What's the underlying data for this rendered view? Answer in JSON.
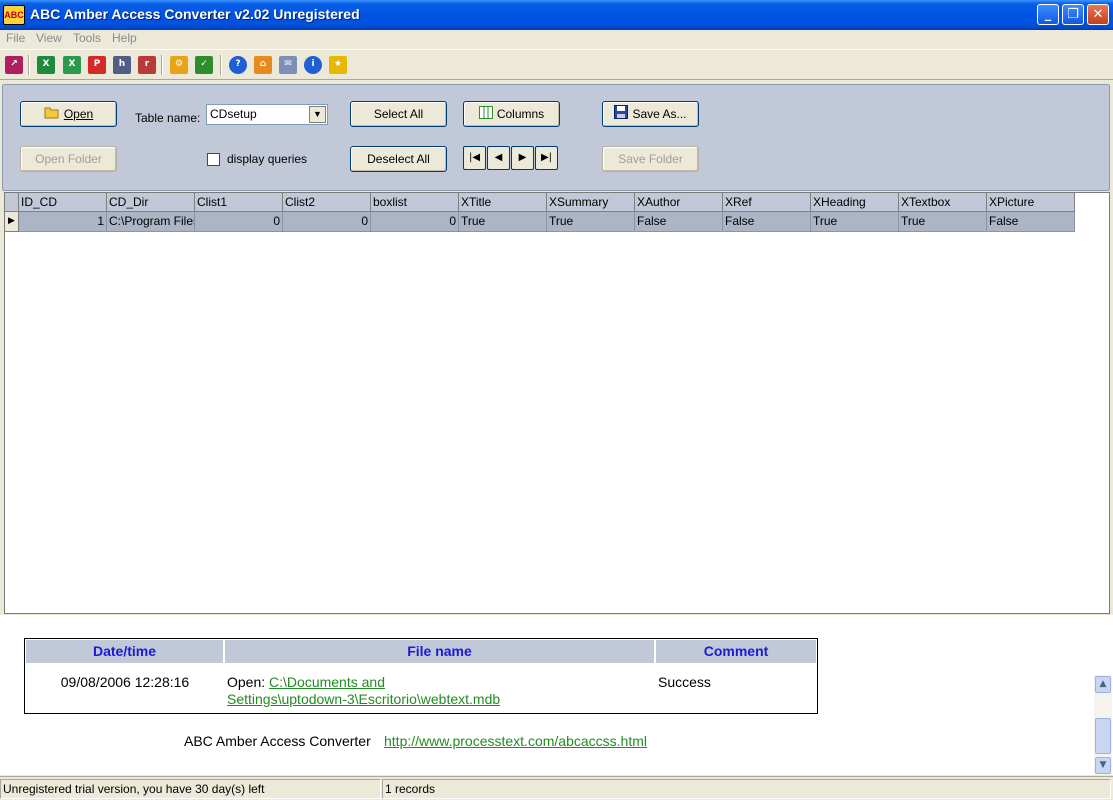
{
  "window": {
    "title": "ABC Amber Access Converter v2.02 Unregistered",
    "icon": "abc-app-icon",
    "minimize_glyph": "_",
    "maximize_glyph": "❐",
    "close_glyph": "✕"
  },
  "menu": [
    "File",
    "View",
    "Tools",
    "Help"
  ],
  "toolbar": {
    "icons": [
      "open-icon",
      "excel-icon",
      "excel-convert-icon",
      "pdf-icon",
      "html-icon",
      "rtf-icon",
      "options-icon",
      "spellcheck-icon",
      "help-icon",
      "home-icon",
      "email-icon",
      "info-icon",
      "register-icon"
    ],
    "glyphs": [
      "↗",
      "X",
      "X",
      "P",
      "h",
      "r",
      "⚙",
      "✓",
      "?",
      "⌂",
      "✉",
      "i",
      "★"
    ]
  },
  "controls": {
    "open_label": "Open",
    "open_folder_label": "Open Folder",
    "table_name_label": "Table name:",
    "table_name_value": "CDsetup",
    "display_queries_label": "display queries",
    "select_all_label": "Select All",
    "deselect_all_label": "Deselect All",
    "columns_label": "Columns",
    "save_as_label": "Save As...",
    "save_folder_label": "Save Folder",
    "nav": [
      "|◀",
      "◀",
      "▶",
      "▶|"
    ]
  },
  "grid": {
    "columns": [
      "ID_CD",
      "CD_Dir",
      "Clist1",
      "Clist2",
      "boxlist",
      "XTitle",
      "XSummary",
      "XAuthor",
      "XRef",
      "XHeading",
      "XTextbox",
      "XPicture"
    ],
    "rows": [
      [
        "1",
        "C:\\Program Files",
        "0",
        "0",
        "0",
        "True",
        "True",
        "False",
        "False",
        "True",
        "True",
        "False"
      ]
    ],
    "row_indicator": "▶"
  },
  "log": {
    "headers": [
      "Date/time",
      "File name",
      "Comment"
    ],
    "entries": [
      {
        "datetime": "09/08/2006 12:28:16",
        "action": "Open:",
        "path_line1": "C:\\Documents and",
        "path_line2": "Settings\\uptodown-3\\Escritorio\\webtext.mdb",
        "comment": "Success"
      }
    ]
  },
  "footer": {
    "app_name": "ABC Amber Access Converter",
    "url": "http://www.processtext.com/abcaccss.html"
  },
  "scrollbar": {
    "up": "▲",
    "down": "▼"
  },
  "status": {
    "trial": "Unregistered trial version, you have 30 day(s) left",
    "records": "1 records"
  }
}
